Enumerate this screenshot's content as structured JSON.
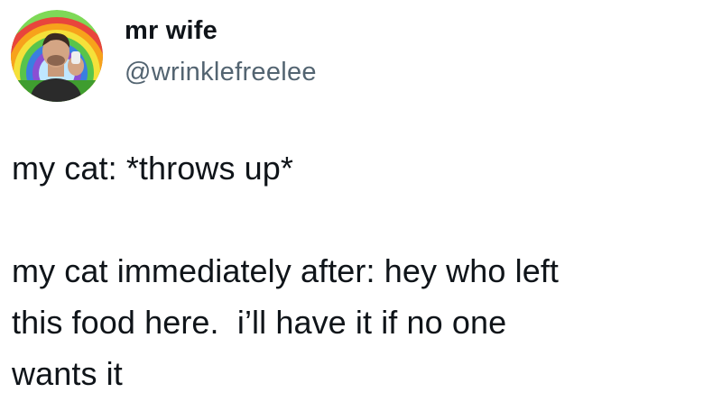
{
  "author": {
    "display_name": "mr wife",
    "handle": "@wrinklefreelee",
    "avatar_icon": "profile-photo-rainbow"
  },
  "tweet": {
    "lines": [
      "my cat: *throws up*",
      "",
      "my cat immediately after: hey who left",
      "this food here.  i’ll have it if no one",
      "wants it"
    ]
  },
  "colors": {
    "text": "#0f1419",
    "secondary_text": "#536471",
    "background": "#ffffff"
  }
}
